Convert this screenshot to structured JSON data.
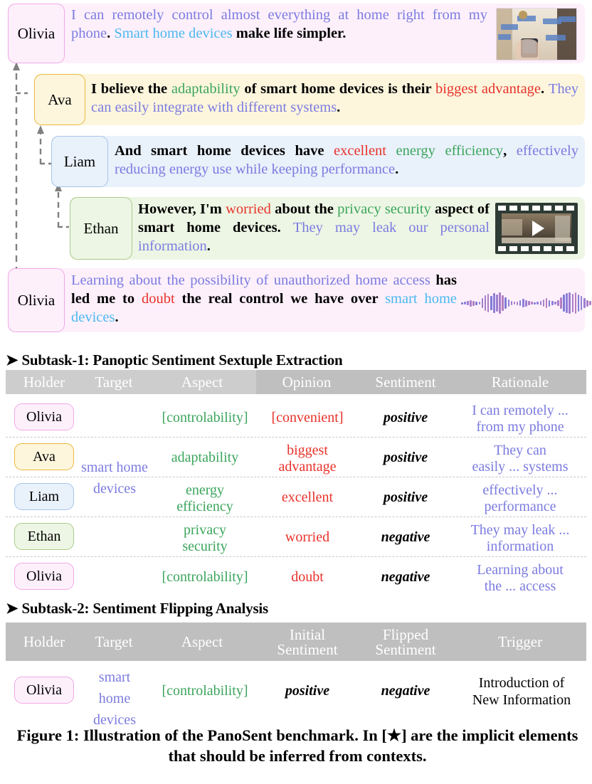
{
  "conversation": {
    "turns": [
      {
        "speaker": "Olivia",
        "segments": [
          {
            "t": "I can remotely control almost everything at home right from my phone",
            "c": "blue"
          },
          {
            "t": ". ",
            "c": "black"
          },
          {
            "t": "Smart home devices",
            "c": "cyan"
          },
          {
            "t": " make life simpler.",
            "c": "black"
          }
        ],
        "attachment": "image-smart-home-room"
      },
      {
        "speaker": "Ava",
        "segments": [
          {
            "t": "I believe the ",
            "c": "black"
          },
          {
            "t": "adaptability",
            "c": "green"
          },
          {
            "t": " of smart home devices is their ",
            "c": "black"
          },
          {
            "t": "biggest advantage",
            "c": "red"
          },
          {
            "t": ". ",
            "c": "black"
          },
          {
            "t": "They can easily integrate with different systems",
            "c": "blue"
          },
          {
            "t": ".",
            "c": "black"
          }
        ],
        "attachment": null
      },
      {
        "speaker": "Liam",
        "segments": [
          {
            "t": "And smart home devices have ",
            "c": "black"
          },
          {
            "t": "excellent",
            "c": "red"
          },
          {
            "t": " ",
            "c": "black"
          },
          {
            "t": "energy efficiency",
            "c": "green"
          },
          {
            "t": ", ",
            "c": "black"
          },
          {
            "t": "effectively reducing energy use while keeping performance",
            "c": "blue"
          },
          {
            "t": ".",
            "c": "black"
          }
        ],
        "attachment": null
      },
      {
        "speaker": "Ethan",
        "segments": [
          {
            "t": "However, I'm ",
            "c": "black"
          },
          {
            "t": "worried",
            "c": "red"
          },
          {
            "t": " about the ",
            "c": "black"
          },
          {
            "t": "privacy security",
            "c": "green"
          },
          {
            "t": " aspect of smart home devices. ",
            "c": "black"
          },
          {
            "t": "They may leak our personal information",
            "c": "blue"
          },
          {
            "t": ".",
            "c": "black"
          }
        ],
        "attachment": "video-smart-home-clip"
      },
      {
        "speaker": "Olivia",
        "segments": [
          {
            "t": "Learning about the possibility of unauthorized home access",
            "c": "blue"
          },
          {
            "t": " has led me to ",
            "c": "black"
          },
          {
            "t": "doubt",
            "c": "red"
          },
          {
            "t": " the real control we have over ",
            "c": "black"
          },
          {
            "t": "smart home devices",
            "c": "cyan"
          },
          {
            "t": ".",
            "c": "black"
          }
        ],
        "attachment": "audio-waveform"
      }
    ]
  },
  "subtask1": {
    "title": "➤ Subtask-1: Panoptic Sentiment Sextuple Extraction",
    "columns": [
      "Holder",
      "Target",
      "Aspect",
      "Opinion",
      "Sentiment",
      "Rationale"
    ],
    "target_span": "smart home devices",
    "rows": [
      {
        "holder": "Olivia",
        "aspect": "[controlability]",
        "opinion": "[convenient]",
        "sentiment": "positive",
        "rationale": "I can remotely ...\nfrom my phone"
      },
      {
        "holder": "Ava",
        "aspect": "adaptability",
        "opinion": "biggest\nadvantage",
        "sentiment": "positive",
        "rationale": "They can\neasily ... systems"
      },
      {
        "holder": "Liam",
        "aspect": "energy\nefficiency",
        "opinion": "excellent",
        "sentiment": "positive",
        "rationale": "effectively ...\nperformance"
      },
      {
        "holder": "Ethan",
        "aspect": "privacy\nsecurity",
        "opinion": "worried",
        "sentiment": "negative",
        "rationale": "They may leak ...\ninformation"
      },
      {
        "holder": "Olivia",
        "aspect": "[controlability]",
        "opinion": "doubt",
        "sentiment": "negative",
        "rationale": "Learning about\nthe ... access"
      }
    ]
  },
  "subtask2": {
    "title": "➤ Subtask-2: Sentiment Flipping Analysis",
    "columns": [
      "Holder",
      "Target",
      "Aspect",
      "Initial\nSentiment",
      "Flipped\nSentiment",
      "Trigger"
    ],
    "rows": [
      {
        "holder": "Olivia",
        "target": "smart\nhome\ndevices",
        "aspect": "[controlability]",
        "initial": "positive",
        "flipped": "negative",
        "trigger": "Introduction of\nNew Information"
      }
    ]
  },
  "caption": "Figure 1: Illustration of the PanoSent benchmark. In [★] are the implicit elements that should be inferred from contexts.",
  "colors": {
    "blue": "#7b7be0",
    "cyan": "#4cb8ef",
    "green": "#3ba55c",
    "red": "#e8322a",
    "header_gray": "#bfbfbf",
    "olivia_bg": "#fdf0fb",
    "olivia_border": "#f0a8e6",
    "ava_bg": "#fdf6dd",
    "ava_border": "#e9b93b",
    "liam_bg": "#e9f1fb",
    "liam_border": "#a8c6e8",
    "ethan_bg": "#edf6e4",
    "ethan_border": "#aacb8a"
  }
}
